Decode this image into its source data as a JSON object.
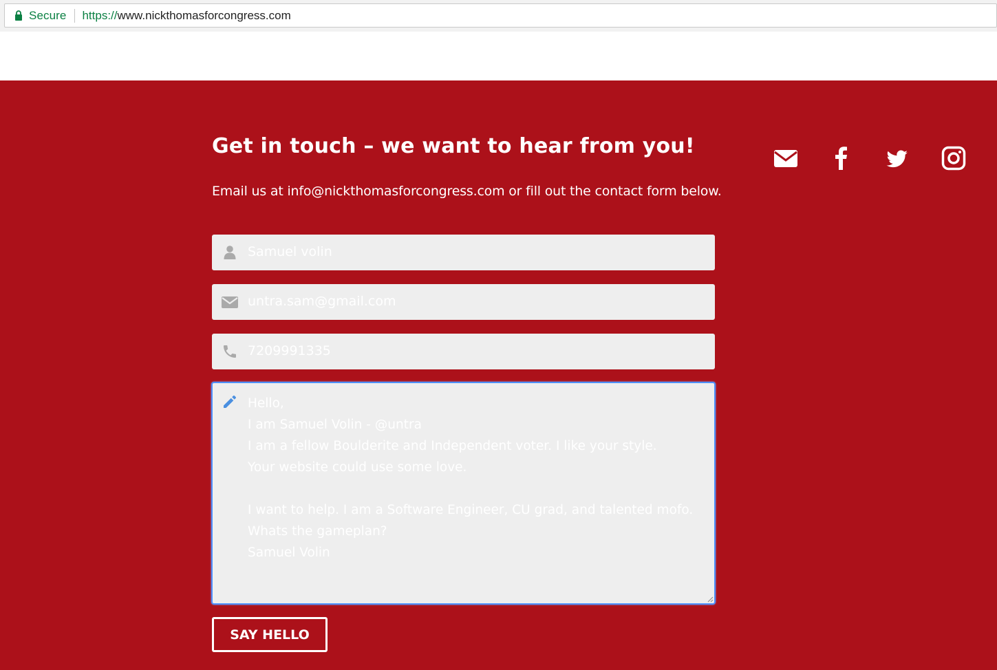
{
  "browser": {
    "secure_label": "Secure",
    "url_scheme": "https://",
    "url_host": "www.nickthomasforcongress.com"
  },
  "contact": {
    "heading": "Get in touch – we want to hear from you!",
    "subtext": "Email us at info@nickthomasforcongress.com or fill out the contact form below.",
    "name_value": "Samuel volin",
    "email_value": "untra.sam@gmail.com",
    "phone_value": "7209991335",
    "message_lines": [
      "Hello,",
      "I am Samuel Volin - @untra",
      "I am a fellow Boulderite and Independent voter. I like your style.",
      "Your website could use some love.",
      "",
      "I want to help. I am a Software Engineer, CU grad, and talented mofo.",
      "Whats the gameplan?",
      "Samuel Volin"
    ],
    "submit_label": "SAY HELLO"
  },
  "social_icons": [
    "envelope-icon",
    "facebook-icon",
    "twitter-icon",
    "instagram-icon"
  ],
  "colors": {
    "section_bg": "#ac111a",
    "field_bg": "#eeeeee",
    "focus_border": "#4d90fe",
    "secure_green": "#0b8043"
  }
}
